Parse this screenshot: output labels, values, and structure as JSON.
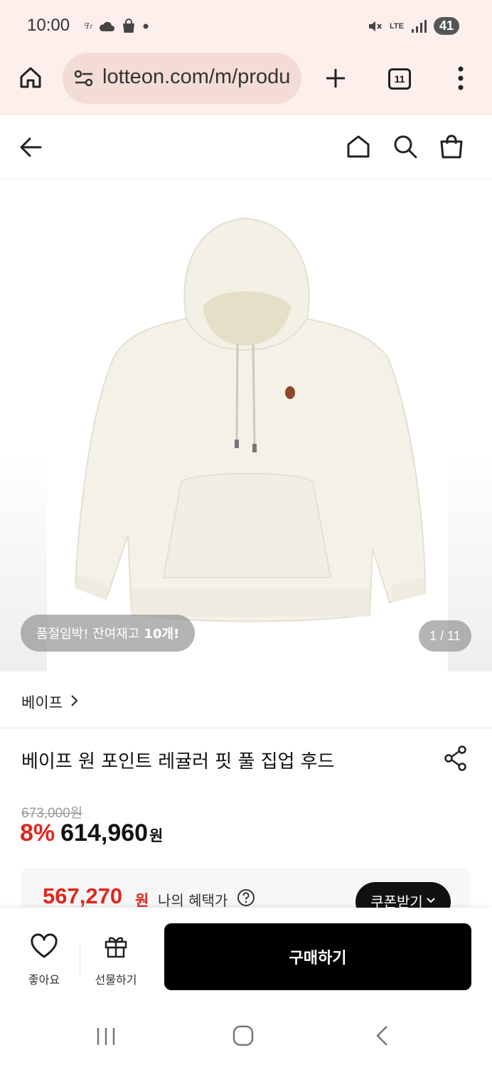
{
  "status_bar": {
    "time": "10:00",
    "network": "LTE",
    "battery": "41",
    "left_icons": [
      "notification-app-icon",
      "cloud-icon",
      "shopping-bag-icon",
      "dot-icon"
    ],
    "right_icons": [
      "mute-icon",
      "lte-icon",
      "signal-icon"
    ]
  },
  "browser": {
    "url": "lotteon.com/m/produ",
    "tab_count": "11",
    "icons": [
      "home-icon",
      "site-settings-icon",
      "new-tab-icon",
      "tabs-icon",
      "menu-icon"
    ]
  },
  "header": {
    "icons": [
      "back-arrow-icon",
      "home-icon",
      "search-icon",
      "cart-icon"
    ]
  },
  "gallery": {
    "stock_text": "품절임박! 잔여재고",
    "stock_count": "10개!",
    "page_counter": "1 / 11"
  },
  "product": {
    "brand": "베이프",
    "title": "베이프 원 포인트 레귤러 핏 풀 집업 후드",
    "original_price": "673,000원",
    "discount_rate": "8%",
    "sale_price": "614,960",
    "sale_unit": "원"
  },
  "benefit": {
    "price": "567,270",
    "unit": "원",
    "label": "나의 혜택가",
    "coupon_button": "쿠폰받기"
  },
  "bottom_bar": {
    "like_label": "좋아요",
    "gift_label": "선물하기",
    "buy_label": "구매하기"
  },
  "colors": {
    "accent_red": "#e1261c",
    "browser_bg": "#fcefec",
    "url_bg": "#f4dcd6",
    "primary_button": "#000000"
  }
}
